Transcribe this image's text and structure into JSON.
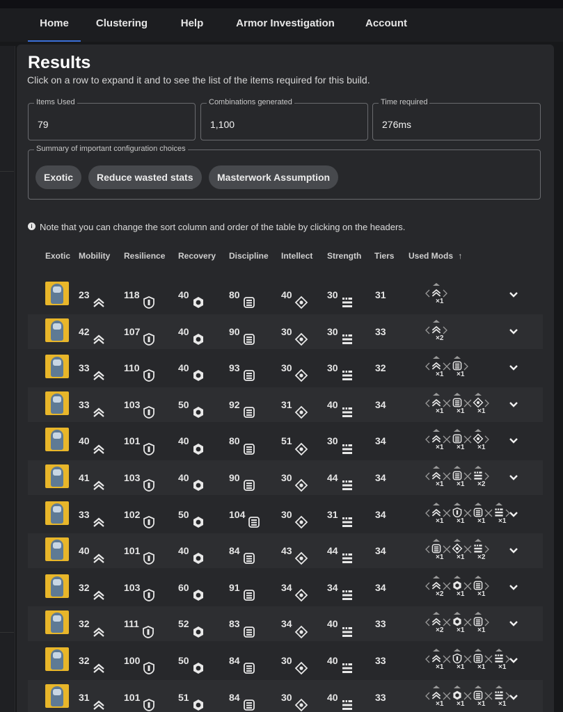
{
  "nav": {
    "tabs": [
      {
        "label": "Home",
        "active": true
      },
      {
        "label": "Clustering",
        "active": false
      },
      {
        "label": "Help",
        "active": false
      },
      {
        "label": "Armor Investigation",
        "active": false
      },
      {
        "label": "Account",
        "active": false
      }
    ]
  },
  "results": {
    "title": "Results",
    "subtitle": "Click on a row to expand it and to see the list of the items required for this build.",
    "fields": [
      {
        "label": "Items Used",
        "value": "79"
      },
      {
        "label": "Combinations generated",
        "value": "1,100"
      },
      {
        "label": "Time required",
        "value": "276ms"
      }
    ],
    "summary_label": "Summary of important configuration choices",
    "chips": [
      "Exotic",
      "Reduce wasted stats",
      "Masterwork Assumption"
    ],
    "note": "Note that you can change the sort column and order of the table by clicking on the headers."
  },
  "table": {
    "headers": [
      "Exotic",
      "Mobility",
      "Resilience",
      "Recovery",
      "Discipline",
      "Intellect",
      "Strength",
      "Tiers",
      "Used Mods"
    ],
    "sort_indicator": "↑",
    "rows": [
      {
        "mobility": "23",
        "resilience": "118",
        "recovery": "40",
        "discipline": "80",
        "intellect": "40",
        "strength": "30",
        "tiers": "31",
        "mods": [
          {
            "icon": "mobility-icon",
            "count": "×1"
          }
        ]
      },
      {
        "mobility": "42",
        "resilience": "107",
        "recovery": "40",
        "discipline": "90",
        "intellect": "30",
        "strength": "30",
        "tiers": "33",
        "mods": [
          {
            "icon": "mobility-icon",
            "count": "×2"
          }
        ]
      },
      {
        "mobility": "33",
        "resilience": "110",
        "recovery": "40",
        "discipline": "93",
        "intellect": "30",
        "strength": "30",
        "tiers": "32",
        "mods": [
          {
            "icon": "mobility-icon",
            "count": "×1"
          },
          {
            "icon": "discipline-icon",
            "count": "×1"
          }
        ]
      },
      {
        "mobility": "33",
        "resilience": "103",
        "recovery": "50",
        "discipline": "92",
        "intellect": "31",
        "strength": "40",
        "tiers": "34",
        "mods": [
          {
            "icon": "mobility-icon",
            "count": "×1"
          },
          {
            "icon": "discipline-icon",
            "count": "×1"
          },
          {
            "icon": "intellect-icon",
            "count": "×1"
          }
        ]
      },
      {
        "mobility": "40",
        "resilience": "101",
        "recovery": "40",
        "discipline": "80",
        "intellect": "51",
        "strength": "30",
        "tiers": "34",
        "mods": [
          {
            "icon": "mobility-icon",
            "count": "×1"
          },
          {
            "icon": "discipline-icon",
            "count": "×1"
          },
          {
            "icon": "intellect-icon",
            "count": "×1"
          }
        ]
      },
      {
        "mobility": "41",
        "resilience": "103",
        "recovery": "40",
        "discipline": "90",
        "intellect": "30",
        "strength": "44",
        "tiers": "34",
        "mods": [
          {
            "icon": "mobility-icon",
            "count": "×1"
          },
          {
            "icon": "discipline-icon",
            "count": "×1"
          },
          {
            "icon": "strength-icon",
            "count": "×2"
          }
        ]
      },
      {
        "mobility": "33",
        "resilience": "102",
        "recovery": "50",
        "discipline": "104",
        "intellect": "30",
        "strength": "31",
        "tiers": "34",
        "mods": [
          {
            "icon": "mobility-icon",
            "count": "×1"
          },
          {
            "icon": "resilience-icon",
            "count": "×1"
          },
          {
            "icon": "discipline-icon",
            "count": "×1"
          },
          {
            "icon": "strength-icon",
            "count": "×1"
          }
        ]
      },
      {
        "mobility": "40",
        "resilience": "101",
        "recovery": "40",
        "discipline": "84",
        "intellect": "43",
        "strength": "44",
        "tiers": "34",
        "mods": [
          {
            "icon": "discipline-icon",
            "count": "×1"
          },
          {
            "icon": "intellect-icon",
            "count": "×1"
          },
          {
            "icon": "strength-icon",
            "count": "×2"
          }
        ]
      },
      {
        "mobility": "32",
        "resilience": "103",
        "recovery": "60",
        "discipline": "91",
        "intellect": "34",
        "strength": "34",
        "tiers": "34",
        "mods": [
          {
            "icon": "mobility-icon",
            "count": "×2"
          },
          {
            "icon": "recovery-icon",
            "count": "×1"
          },
          {
            "icon": "discipline-icon",
            "count": "×1"
          }
        ]
      },
      {
        "mobility": "32",
        "resilience": "111",
        "recovery": "52",
        "discipline": "83",
        "intellect": "34",
        "strength": "40",
        "tiers": "33",
        "mods": [
          {
            "icon": "mobility-icon",
            "count": "×2"
          },
          {
            "icon": "recovery-icon",
            "count": "×1"
          },
          {
            "icon": "discipline-icon",
            "count": "×1"
          }
        ]
      },
      {
        "mobility": "32",
        "resilience": "100",
        "recovery": "50",
        "discipline": "84",
        "intellect": "30",
        "strength": "40",
        "tiers": "33",
        "mods": [
          {
            "icon": "mobility-icon",
            "count": "×1"
          },
          {
            "icon": "resilience-icon",
            "count": "×1"
          },
          {
            "icon": "discipline-icon",
            "count": "×1"
          },
          {
            "icon": "strength-icon",
            "count": "×1"
          }
        ]
      },
      {
        "mobility": "31",
        "resilience": "101",
        "recovery": "51",
        "discipline": "84",
        "intellect": "30",
        "strength": "40",
        "tiers": "33",
        "mods": [
          {
            "icon": "mobility-icon",
            "count": "×1"
          },
          {
            "icon": "recovery-icon",
            "count": "×1"
          },
          {
            "icon": "discipline-icon",
            "count": "×1"
          },
          {
            "icon": "strength-icon",
            "count": "×1"
          }
        ]
      }
    ]
  }
}
